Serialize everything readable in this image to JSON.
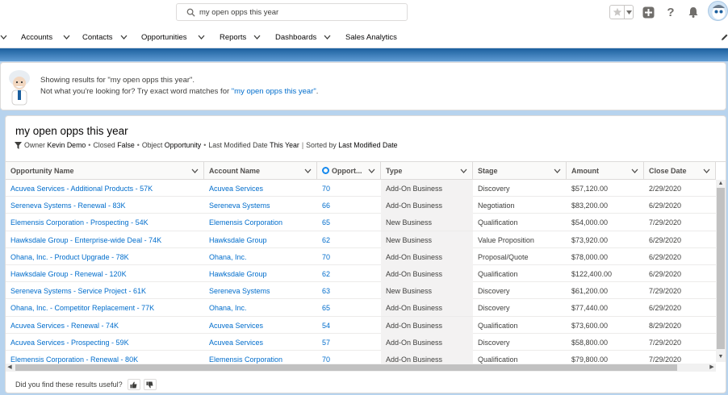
{
  "search": {
    "value": "my open opps this year"
  },
  "nav": {
    "items": [
      {
        "label": "Accounts"
      },
      {
        "label": "Contacts"
      },
      {
        "label": "Opportunities"
      },
      {
        "label": "Reports"
      },
      {
        "label": "Dashboards"
      },
      {
        "label": "Sales Analytics"
      }
    ]
  },
  "notice": {
    "line1": "Showing results for \"my open opps this year\".",
    "line2_prefix": "Not what you're looking for? Try exact word matches for ",
    "line2_link": "\"my open opps this year\"",
    "line2_suffix": "."
  },
  "results": {
    "title": "my open opps this year",
    "filters": {
      "owner_label": "Owner",
      "owner_value": "Kevin Demo",
      "closed_label": "Closed",
      "closed_value": "False",
      "object_label": "Object",
      "object_value": "Opportunity",
      "lmd_label": "Last Modified Date",
      "lmd_value": "This Year",
      "sorted_label": "Sorted by",
      "sorted_value": "Last Modified Date",
      "bullet": "•",
      "pipe": "|"
    },
    "columns": [
      {
        "label": "Opportunity Name"
      },
      {
        "label": "Account Name"
      },
      {
        "label": "Opport..."
      },
      {
        "label": "Type"
      },
      {
        "label": "Stage"
      },
      {
        "label": "Amount"
      },
      {
        "label": "Close Date"
      }
    ],
    "rows": [
      {
        "opportunity": "Acuvea Services - Additional Products - 57K",
        "account": "Acuvea Services",
        "probability": "70",
        "type": "Add-On Business",
        "stage": "Discovery",
        "amount": "$57,120.00",
        "close_date": "2/29/2020"
      },
      {
        "opportunity": "Sereneva Systems - Renewal - 83K",
        "account": "Sereneva Systems",
        "probability": "66",
        "type": "Add-On Business",
        "stage": "Negotiation",
        "amount": "$83,200.00",
        "close_date": "6/29/2020"
      },
      {
        "opportunity": "Elemensis Corporation - Prospecting - 54K",
        "account": "Elemensis Corporation",
        "probability": "65",
        "type": "New Business",
        "stage": "Qualification",
        "amount": "$54,000.00",
        "close_date": "7/29/2020"
      },
      {
        "opportunity": "Hawksdale Group - Enterprise-wide Deal - 74K",
        "account": "Hawksdale Group",
        "probability": "62",
        "type": "New Business",
        "stage": "Value Proposition",
        "amount": "$73,920.00",
        "close_date": "6/29/2020"
      },
      {
        "opportunity": "Ohana, Inc. - Product Upgrade - 78K",
        "account": "Ohana, Inc.",
        "probability": "70",
        "type": "Add-On Business",
        "stage": "Proposal/Quote",
        "amount": "$78,000.00",
        "close_date": "6/29/2020"
      },
      {
        "opportunity": "Hawksdale Group - Renewal - 120K",
        "account": "Hawksdale Group",
        "probability": "62",
        "type": "Add-On Business",
        "stage": "Qualification",
        "amount": "$122,400.00",
        "close_date": "6/29/2020"
      },
      {
        "opportunity": "Sereneva Systems - Service Project - 61K",
        "account": "Sereneva Systems",
        "probability": "63",
        "type": "New Business",
        "stage": "Discovery",
        "amount": "$61,200.00",
        "close_date": "7/29/2020"
      },
      {
        "opportunity": "Ohana, Inc. - Competitor Replacement - 77K",
        "account": "Ohana, Inc.",
        "probability": "65",
        "type": "Add-On Business",
        "stage": "Discovery",
        "amount": "$77,440.00",
        "close_date": "6/29/2020"
      },
      {
        "opportunity": "Acuvea Services - Renewal - 74K",
        "account": "Acuvea Services",
        "probability": "54",
        "type": "Add-On Business",
        "stage": "Qualification",
        "amount": "$73,600.00",
        "close_date": "8/29/2020"
      },
      {
        "opportunity": "Acuvea Services - Prospecting - 59K",
        "account": "Acuvea Services",
        "probability": "57",
        "type": "Add-On Business",
        "stage": "Discovery",
        "amount": "$58,800.00",
        "close_date": "7/29/2020"
      },
      {
        "opportunity": "Elemensis Corporation - Renewal - 80K",
        "account": "Elemensis Corporation",
        "probability": "70",
        "type": "Add-On Business",
        "stage": "Qualification",
        "amount": "$79,800.00",
        "close_date": "7/29/2020"
      }
    ],
    "feedback": "Did you find these results useful?"
  },
  "colors": {
    "link": "#006dcc",
    "brand": "#1589ee",
    "band": "#b7d3ee"
  },
  "icons": [
    "search-icon",
    "star-icon",
    "chevron-down-icon",
    "plus-icon",
    "help-icon",
    "bell-icon",
    "avatar",
    "pencil-icon",
    "einstein-mascot",
    "filter-icon",
    "thumbs-up-icon",
    "thumbs-down-icon"
  ]
}
